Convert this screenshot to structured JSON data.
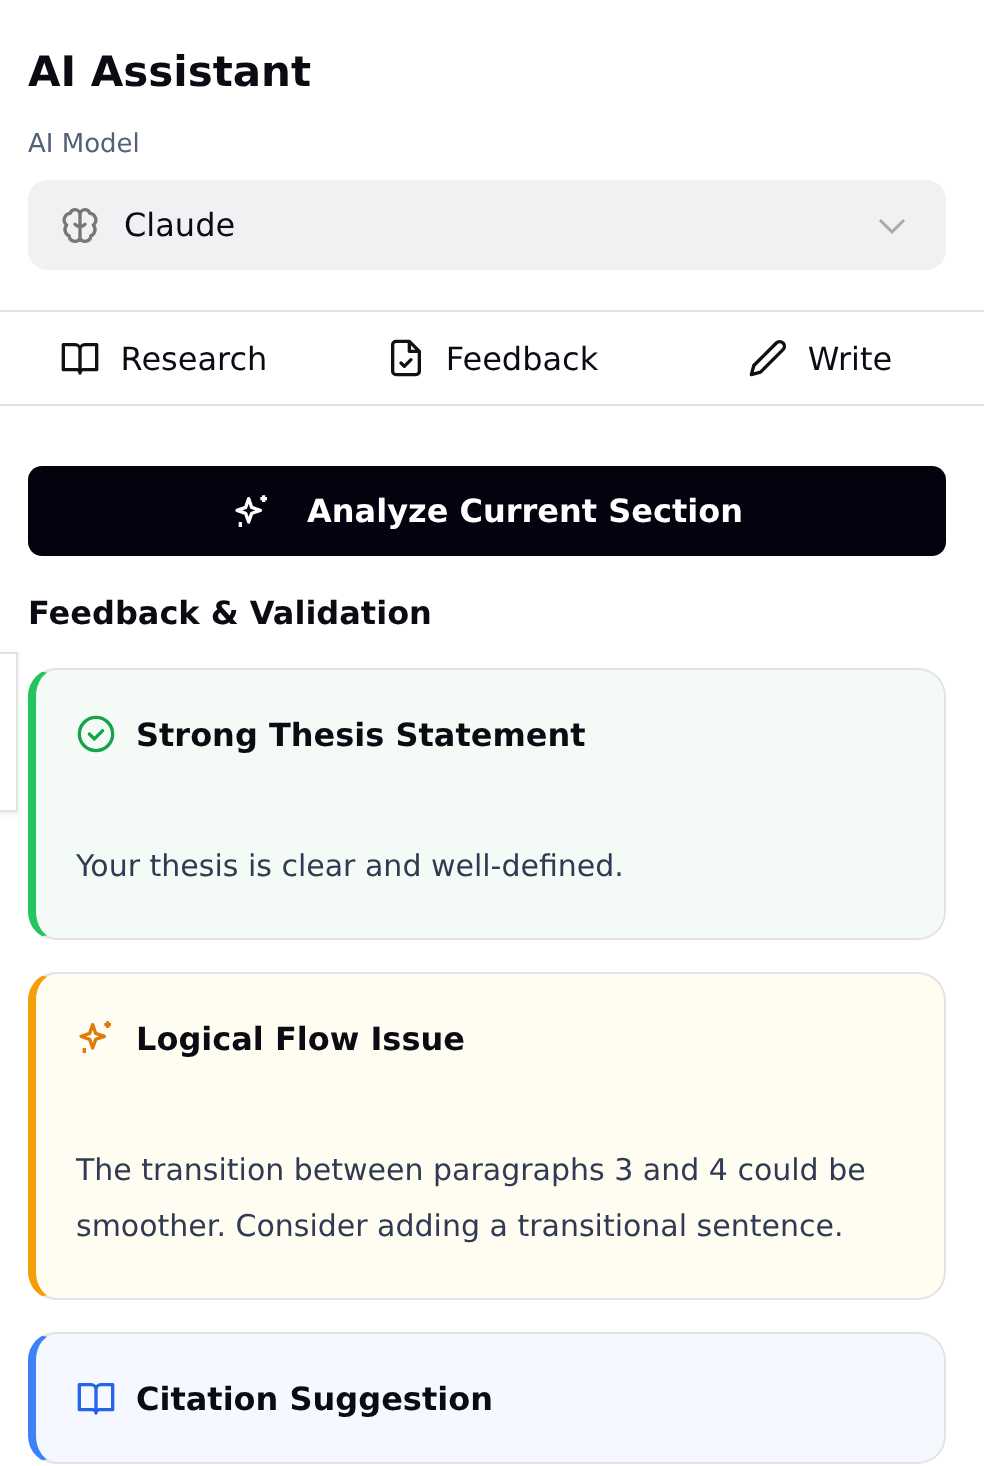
{
  "title": "AI Assistant",
  "model": {
    "label": "AI Model",
    "value": "Claude"
  },
  "tabs": [
    {
      "label": "Research"
    },
    {
      "label": "Feedback"
    },
    {
      "label": "Write"
    }
  ],
  "analyze_button": "Analyze Current Section",
  "section_title": "Feedback & Validation",
  "feedback": [
    {
      "kind": "success",
      "title": "Strong Thesis Statement",
      "text": "Your thesis is clear and well-defined."
    },
    {
      "kind": "warning",
      "title": "Logical Flow Issue",
      "text": "The transition between paragraphs 3 and 4 could be smoother. Consider adding a transitional sentence."
    },
    {
      "kind": "info",
      "title": "Citation Suggestion"
    }
  ]
}
